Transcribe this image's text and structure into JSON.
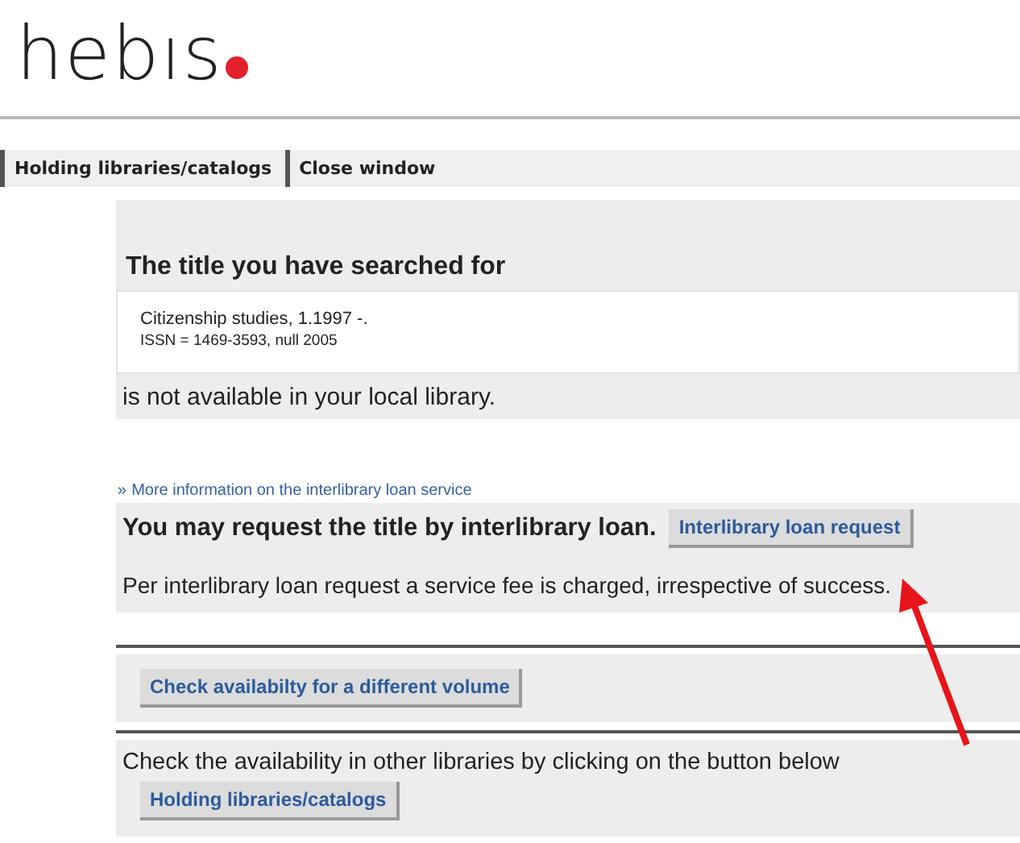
{
  "logo": {
    "text": "hebıs"
  },
  "nav": [
    {
      "label": "Holding libraries/catalogs"
    },
    {
      "label": "Close window"
    }
  ],
  "search_result": {
    "heading": "The title you have searched for",
    "title_line": "Citizenship studies, 1.1997 -.",
    "issn_line": "ISSN = 1469-3593, null 2005",
    "status": "is not available in your local library."
  },
  "info_link": {
    "marker": "»",
    "text": "More information on the interlibrary loan service"
  },
  "loan": {
    "heading": "You may request the title by interlibrary loan.",
    "button": "Interlibrary loan request",
    "fee_note": "Per interlibrary loan request a service fee is charged, irrespective of success."
  },
  "volume": {
    "button": "Check availabilty for a different volume"
  },
  "other": {
    "text": "Check the availability in other libraries by clicking on the button below",
    "button": "Holding libraries/catalogs"
  }
}
